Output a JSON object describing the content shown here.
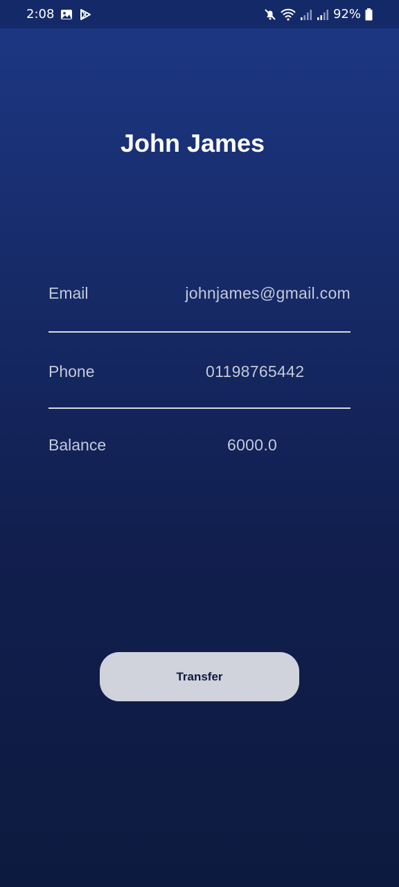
{
  "status_bar": {
    "time": "2:08",
    "battery_percent": "92%",
    "icons": [
      "image-icon",
      "play-store-icon",
      "mute-icon",
      "wifi-icon",
      "signal-icon",
      "signal-icon",
      "battery-icon"
    ]
  },
  "profile": {
    "name": "John James"
  },
  "details": {
    "email_label": "Email",
    "email_value": "johnjames@gmail.com",
    "phone_label": "Phone",
    "phone_value": "01198765442",
    "balance_label": "Balance",
    "balance_value": "6000.0"
  },
  "actions": {
    "transfer_label": "Transfer"
  },
  "colors": {
    "background_top": "#1d3886",
    "background_bottom": "#0d1a3f",
    "status_bar": "#142a68",
    "button_bg": "#d0d3dc",
    "button_text": "#0d1a3f",
    "label_text": "#c4c9da"
  }
}
